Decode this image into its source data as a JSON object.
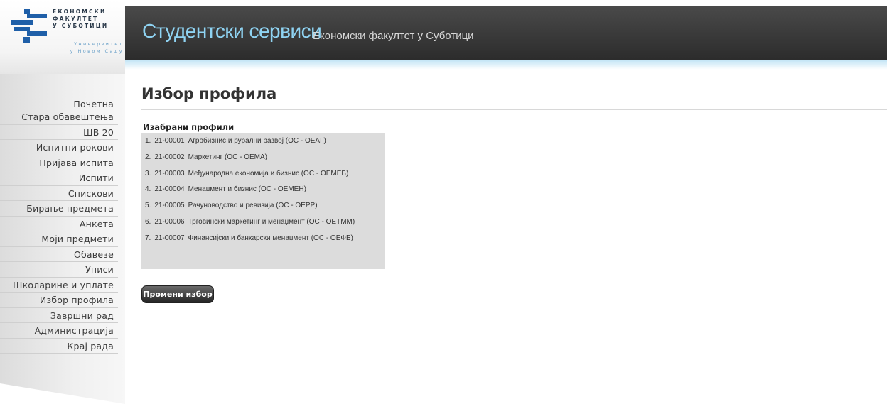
{
  "header": {
    "title": "Студентски сервиси",
    "subtitle": "Економски факултет у Суботици"
  },
  "logo": {
    "line1": "ЕКОНОМСКИ",
    "line2": "ФАКУЛТЕТ",
    "line3": "У СУБОТИЦИ",
    "sub1": "Универзитет",
    "sub2": "у Новом Саду"
  },
  "sidebar": {
    "items": [
      "Почетна",
      "Стара обавештења",
      "ШВ 20",
      "Испитни рокови",
      "Пријава испита",
      "Испити",
      "Спискови",
      "Бирање предмета",
      "Анкета",
      "Моји предмети",
      "Обавезе",
      "Уписи",
      "Школарине и уплате",
      "Избор профила",
      "Завршни рад",
      "Администрација",
      "Крај рада"
    ]
  },
  "main": {
    "title": "Избор профила",
    "section_label": "Изабрани профили",
    "profiles": [
      {
        "num": "1.",
        "code": "21-00001",
        "name": "Агробизнис и рурални развој (ОС - ОЕАГ)"
      },
      {
        "num": "2.",
        "code": "21-00002",
        "name": "Маркетинг (ОС - ОЕМА)"
      },
      {
        "num": "3.",
        "code": "21-00003",
        "name": "Међународна економија и бизнис (ОС - ОЕМЕБ)"
      },
      {
        "num": "4.",
        "code": "21-00004",
        "name": "Менаџмент и бизнис (ОС - ОЕМЕН)"
      },
      {
        "num": "5.",
        "code": "21-00005",
        "name": "Рачуноводство и ревизија (ОС - ОЕРР)"
      },
      {
        "num": "6.",
        "code": "21-00006",
        "name": "Трговински маркетинг и менаџмент (ОС - ОЕТММ)"
      },
      {
        "num": "7.",
        "code": "21-00007",
        "name": "Финансијски и банкарски менаџмент (ОС - ОЕФБ)"
      }
    ],
    "change_button": "Промени избор"
  },
  "colors": {
    "header_bg": "#2c2c2c",
    "title_accent": "#8fd3f2",
    "logo_blue": "#1f5fa8",
    "profiles_bg": "#dcdcdc"
  }
}
